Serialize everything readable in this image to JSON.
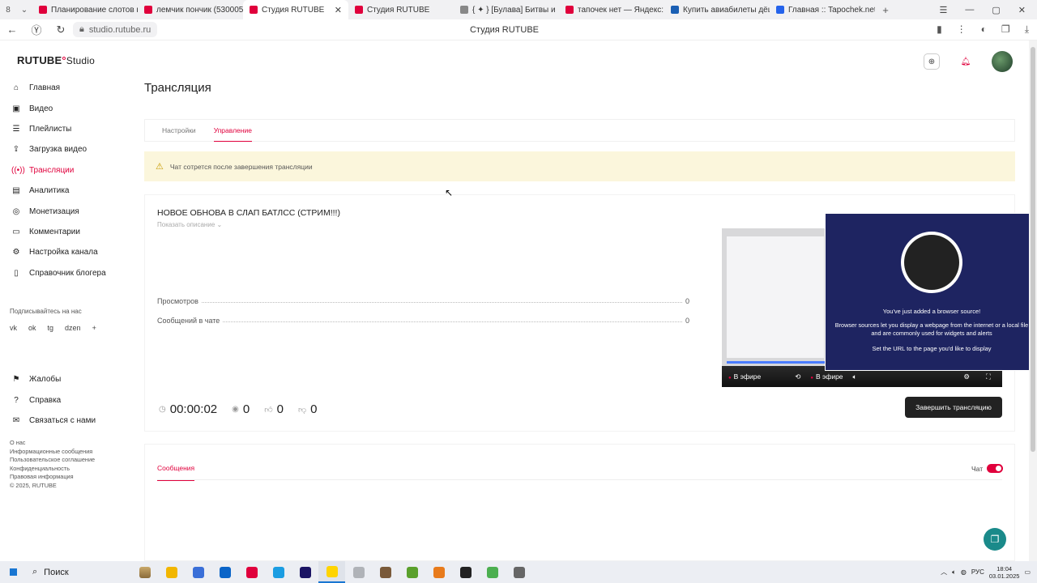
{
  "browser": {
    "tabs": [
      {
        "label": "Планирование слотов на",
        "color": "#e0003c"
      },
      {
        "label": "лемчик пончик (53000566",
        "color": "#e0003c"
      },
      {
        "label": "Студия RUTUBE",
        "color": "#e0003c",
        "active": true
      },
      {
        "label": "Студия RUTUBE",
        "color": "#e0003c"
      },
      {
        "label": "{ ✦ } [Булава] Битвы и",
        "color": "#888888"
      },
      {
        "label": "тапочек нет — Яндекс: н",
        "color": "#e0003c"
      },
      {
        "label": "Купить авиабилеты дёшев",
        "color": "#1a5fb4"
      },
      {
        "label": "Главная :: Tapochek.net",
        "color": "#2563eb"
      }
    ],
    "tab_count": "8",
    "url": "studio.rutube.ru",
    "page_title": "Студия RUTUBE"
  },
  "sidebar": {
    "logo_main": "RUTUBE",
    "logo_studio": "Studio",
    "items": [
      {
        "label": "Главная",
        "icon": "home-icon",
        "glyph": "⌂"
      },
      {
        "label": "Видео",
        "icon": "video-icon",
        "glyph": "▣"
      },
      {
        "label": "Плейлисты",
        "icon": "playlist-icon",
        "glyph": "☰"
      },
      {
        "label": "Загрузка видео",
        "icon": "upload-icon",
        "glyph": "⇪"
      },
      {
        "label": "Трансляции",
        "icon": "broadcast-icon",
        "glyph": "((•))",
        "active": true
      },
      {
        "label": "Аналитика",
        "icon": "analytics-icon",
        "glyph": "▤"
      },
      {
        "label": "Монетизация",
        "icon": "money-icon",
        "glyph": "◎"
      },
      {
        "label": "Комментарии",
        "icon": "comments-icon",
        "glyph": "▭"
      },
      {
        "label": "Настройка канала",
        "icon": "gear-icon",
        "glyph": "⚙"
      },
      {
        "label": "Справочник блогера",
        "icon": "book-icon",
        "glyph": "▯"
      }
    ],
    "subscribe_label": "Подписывайтесь на нас",
    "socials": [
      "vk",
      "ok",
      "tg",
      "dzen",
      "+"
    ],
    "items2": [
      {
        "label": "Жалобы",
        "icon": "flag-icon",
        "glyph": "⚑"
      },
      {
        "label": "Справка",
        "icon": "help-icon",
        "glyph": "?"
      },
      {
        "label": "Связаться с нами",
        "icon": "mail-icon",
        "glyph": "✉"
      }
    ],
    "footer_links": [
      "О нас",
      "Информационные сообщения",
      "Пользовательское соглашение",
      "Конфиденциальность",
      "Правовая информация",
      "© 2025, RUTUBE"
    ]
  },
  "main": {
    "page_heading": "Трансляция",
    "tabs": [
      "Настройки",
      "Управление"
    ],
    "active_tab": "Управление",
    "warning": "Чат сотрется после завершения трансляции",
    "stream_title": "НОВОЕ ОБНОВА В СЛАП БАТЛСС (СТРИМ!!!)",
    "show_description": "Показать описание ⌄",
    "stats": [
      {
        "label": "Просмотров",
        "value": "0"
      },
      {
        "label": "Сообщений в чате",
        "value": "0"
      }
    ],
    "duration": "00:00:02",
    "viewers": "0",
    "likes": "0",
    "dislikes": "0",
    "end_button": "Завершить трансляцию",
    "player": {
      "live_label": "В эфире",
      "live_label2": "В эфире"
    },
    "messages_tab": "Сообщения",
    "chat_label": "Чат"
  },
  "obs": {
    "line1": "You've just added a browser source!",
    "line2": "Browser sources let you display a webpage from the internet or a local file and are commonly used for widgets and alerts",
    "line3": "Set the URL to the page you'd like to display"
  },
  "taskbar": {
    "search": "Поиск",
    "lang": "РУС",
    "time": "18:04",
    "date": "03.01.2025",
    "apps": [
      {
        "name": "file-explorer",
        "color": "#f2b600"
      },
      {
        "name": "store",
        "color": "#3a6fd8"
      },
      {
        "name": "outlook",
        "color": "#0a64c8"
      },
      {
        "name": "yandex",
        "color": "#e0003c"
      },
      {
        "name": "edge",
        "color": "#1b9de2"
      },
      {
        "name": "animate",
        "color": "#1b1464"
      },
      {
        "name": "yandex-browser",
        "color": "#ffd400",
        "active": true
      },
      {
        "name": "app-x",
        "color": "#b0b3b8"
      },
      {
        "name": "app-wot",
        "color": "#7a5a3a"
      },
      {
        "name": "minecraft",
        "color": "#5aa02c"
      },
      {
        "name": "game",
        "color": "#e87b1c"
      },
      {
        "name": "obs",
        "color": "#222222"
      },
      {
        "name": "utorrent",
        "color": "#4caf50"
      },
      {
        "name": "settings",
        "color": "#666666"
      }
    ]
  }
}
